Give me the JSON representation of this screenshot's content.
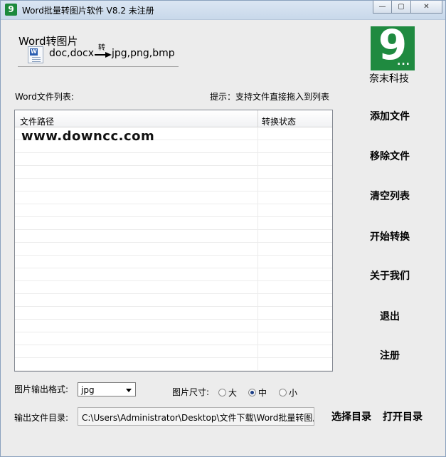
{
  "window": {
    "title": "Word批量转图片软件 V8.2 未注册",
    "icon_glyph": "9",
    "controls": {
      "minimize": "—",
      "maximize": "▢",
      "close": "✕"
    }
  },
  "header": {
    "title": "Word转图片",
    "from_formats": "doc,docx",
    "arrow_caption": "转",
    "to_formats": "jpg,png,bmp"
  },
  "logo": {
    "glyph": "9",
    "dots": "...",
    "company": "奈末科技",
    "color": "#1f8a40"
  },
  "file_list": {
    "label": "Word文件列表:",
    "hint": "提示：支持文件直接拖入到列表",
    "columns": [
      "文件路径",
      "转换状态"
    ],
    "watermark": "www.downcc.com"
  },
  "actions": {
    "add_file": "添加文件",
    "remove_file": "移除文件",
    "clear_list": "清空列表",
    "start_convert": "开始转换",
    "about": "关于我们",
    "exit": "退出",
    "register": "注册"
  },
  "output_format": {
    "label": "图片输出格式:",
    "selected": "jpg"
  },
  "image_size": {
    "label": "图片尺寸:",
    "options": [
      "大",
      "中",
      "小"
    ],
    "selected": "中"
  },
  "output_dir": {
    "label": "输出文件目录:",
    "value": "C:\\Users\\Administrator\\Desktop\\文件下载\\Word批量转图片软件",
    "choose_button": "选择目录",
    "open_button": "打开目录"
  }
}
